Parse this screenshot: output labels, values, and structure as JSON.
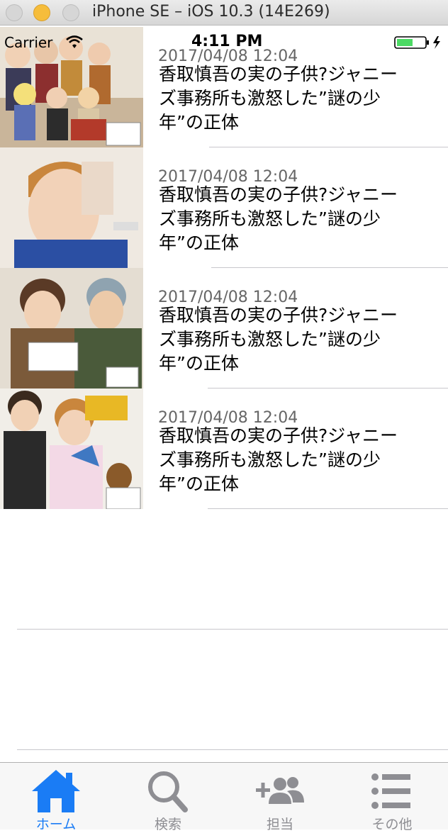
{
  "window": {
    "title": "iPhone SE – iOS 10.3 (14E269)"
  },
  "status_bar": {
    "carrier": "Carrier",
    "time": "4:11 PM"
  },
  "articles": [
    {
      "date": "2017/04/08 12:04",
      "title": "香取慎吾の実の子供?ジャニーズ事務所も激怒した”謎の少年”の正体",
      "thumb_desc": "group-photo"
    },
    {
      "date": "2017/04/08 12:04",
      "title": "香取慎吾の実の子供?ジャニーズ事務所も激怒した”謎の少年”の正体",
      "thumb_desc": "portrait"
    },
    {
      "date": "2017/04/08 12:04",
      "title": "香取慎吾の実の子供?ジャニーズ事務所も激怒した”謎の少年”の正体",
      "thumb_desc": "duo-photo"
    },
    {
      "date": "2017/04/08 12:04",
      "title": "香取慎吾の実の子供?ジャニーズ事務所も激怒した”謎の少年”の正体",
      "thumb_desc": "duo-photo"
    }
  ],
  "tabbar": {
    "tabs": [
      {
        "label": "ホーム",
        "icon": "home-icon",
        "active": true
      },
      {
        "label": "検索",
        "icon": "search-icon",
        "active": false
      },
      {
        "label": "担当",
        "icon": "add-people-icon",
        "active": false
      },
      {
        "label": "その他",
        "icon": "list-icon",
        "active": false
      }
    ]
  },
  "colors": {
    "accent": "#1a7cf5",
    "tab_inactive": "#8e8e93",
    "separator": "#c8c7cc"
  }
}
